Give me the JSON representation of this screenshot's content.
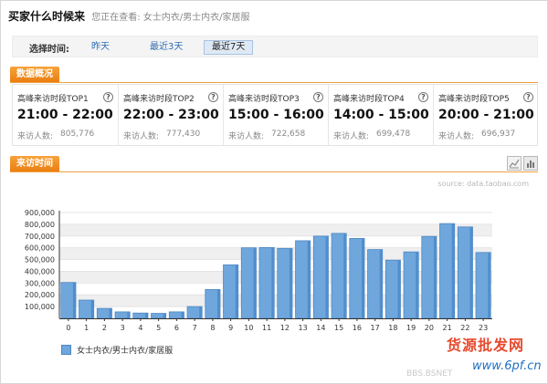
{
  "header": {
    "title": "买家什么时候来",
    "subtitle": "您正在查看: 女士内衣/男士内衣/家居服"
  },
  "range_selector": {
    "label": "选择时间:",
    "options": [
      {
        "label": "昨天",
        "active": false
      },
      {
        "label": "最近3天",
        "active": false
      },
      {
        "label": "最近7天",
        "active": true
      }
    ]
  },
  "stats_section": {
    "title": "数据概况",
    "cards": [
      {
        "label": "高峰来访时段TOP1",
        "range": "21:00 - 22:00",
        "visitors_label": "来访人数:",
        "visitors": "805,776"
      },
      {
        "label": "高峰来访时段TOP2",
        "range": "22:00 - 23:00",
        "visitors_label": "来访人数:",
        "visitors": "777,430"
      },
      {
        "label": "高峰来访时段TOP3",
        "range": "15:00 - 16:00",
        "visitors_label": "来访人数:",
        "visitors": "722,658"
      },
      {
        "label": "高峰来访时段TOP4",
        "range": "14:00 - 15:00",
        "visitors_label": "来访人数:",
        "visitors": "699,478"
      },
      {
        "label": "高峰来访时段TOP5",
        "range": "20:00 - 21:00",
        "visitors_label": "来访人数:",
        "visitors": "696,937"
      }
    ]
  },
  "visit_section": {
    "title": "来访时间",
    "source": "source: data.taobao.com"
  },
  "chart_data": {
    "type": "bar",
    "title": "",
    "xlabel": "",
    "ylabel": "",
    "categories": [
      "0",
      "1",
      "2",
      "3",
      "4",
      "5",
      "6",
      "7",
      "8",
      "9",
      "10",
      "11",
      "12",
      "13",
      "14",
      "15",
      "16",
      "17",
      "18",
      "19",
      "20",
      "21",
      "22",
      "23"
    ],
    "series": [
      {
        "name": "女士内衣/男士内衣/家居服",
        "values": [
          305000,
          155000,
          85000,
          55000,
          45000,
          42000,
          55000,
          100000,
          245000,
          455000,
          600000,
          602000,
          595000,
          660000,
          699478,
          722658,
          680000,
          585000,
          495000,
          565000,
          696937,
          805776,
          777430,
          560000
        ]
      }
    ],
    "ylim": [
      0,
      900000
    ],
    "yticks": [
      "100,000",
      "200,000",
      "300,000",
      "400,000",
      "500,000",
      "600,000",
      "700,000",
      "800,000",
      "900,000"
    ],
    "grid": true,
    "legend": "bottom-left",
    "bar_color": "#6fa7dd",
    "bar_edge_color": "#4d86c2"
  },
  "watermark": {
    "red": "货源批发网",
    "blue": "www.6pf.cn",
    "faint": "BBS.BSNET"
  },
  "colors": {
    "tab_orange": "#f08a1c",
    "link_blue": "#2f6eb5"
  }
}
